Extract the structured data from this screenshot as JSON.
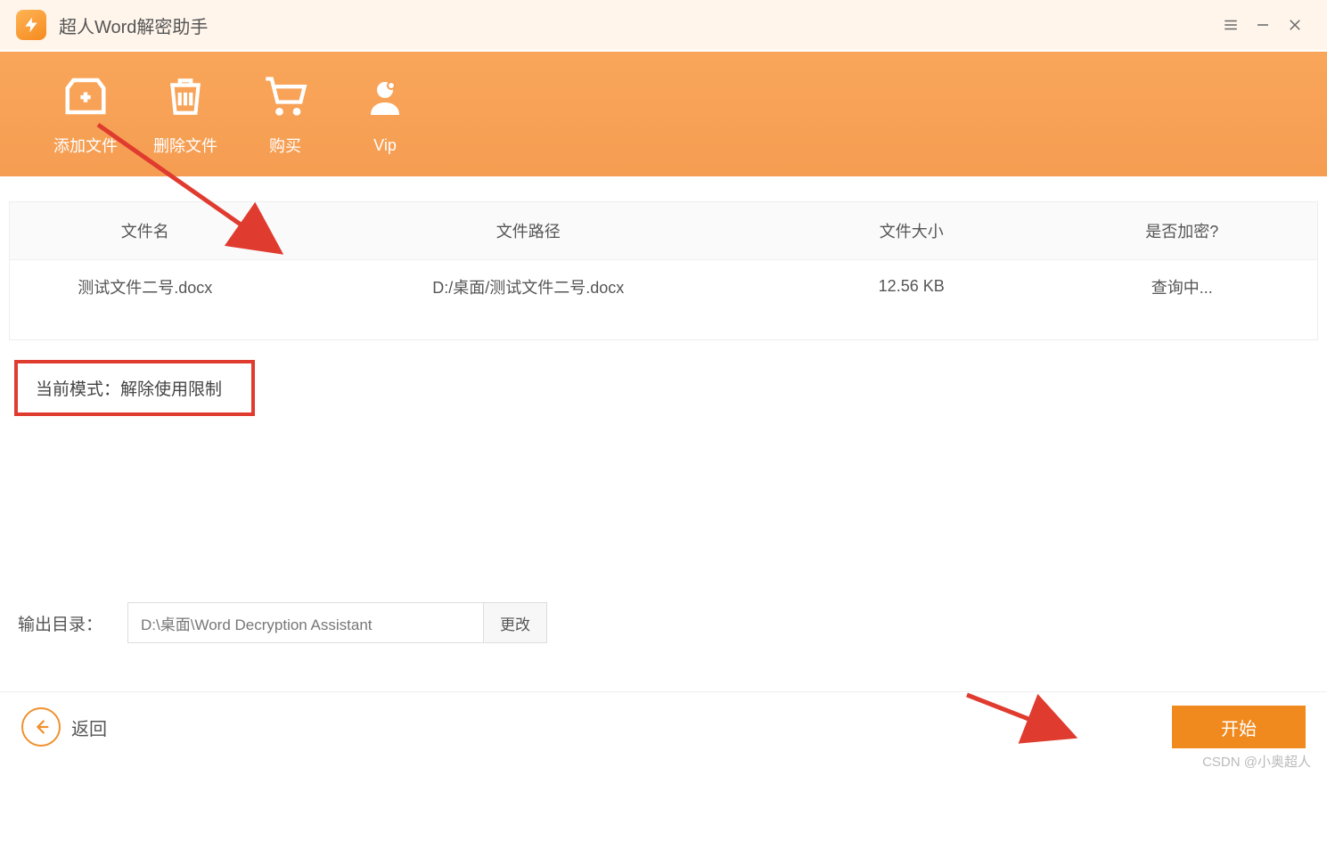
{
  "app": {
    "title": "超人Word解密助手"
  },
  "toolbar": {
    "add_file": "添加文件",
    "delete_file": "删除文件",
    "purchase": "购买",
    "vip": "Vip"
  },
  "table": {
    "headers": {
      "name": "文件名",
      "path": "文件路径",
      "size": "文件大小",
      "encrypted": "是否加密?"
    },
    "row": {
      "name": "测试文件二号.docx",
      "path": "D:/桌面/测试文件二号.docx",
      "size": "12.56 KB",
      "encrypted": "查询中..."
    }
  },
  "mode": {
    "label": "当前模式：解除使用限制"
  },
  "output": {
    "label": "输出目录：",
    "value": "D:\\桌面\\Word Decryption Assistant",
    "change": "更改"
  },
  "footer": {
    "back": "返回",
    "start": "开始"
  },
  "watermark": "CSDN @小奥超人"
}
